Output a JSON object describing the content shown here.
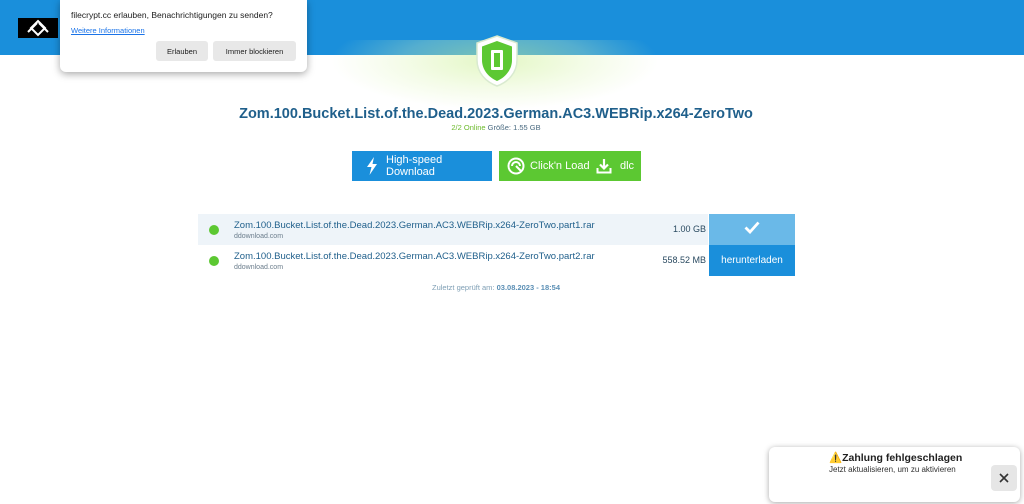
{
  "permission_prompt": {
    "title": "filecrypt.cc erlauben, Benachrichtigungen zu senden?",
    "more_info_link": "Weitere Informationen",
    "allow_button": "Erlauben",
    "block_button": "Immer blockieren"
  },
  "header": {
    "logo_icon": "filecrypt-logo-icon",
    "shield_icon": "shield-icon",
    "colors": {
      "bar": "#1a8fdb",
      "shield": "#5cc832"
    }
  },
  "container": {
    "title": "Zom.100.Bucket.List.of.the.Dead.2023.German.AC3.WEBRip.x264-ZeroTwo",
    "online_status": "2/2 Online",
    "size_label": "Größe: 1.55 GB"
  },
  "buttons": {
    "highspeed": "High-speed Download",
    "clickn_load": "Click'n Load",
    "dlc": "dlc",
    "highspeed_icon": "lightning-icon",
    "clickn_load_icon": "cnl-icon",
    "dlc_icon": "download-icon"
  },
  "files": [
    {
      "name": "Zom.100.Bucket.List.of.the.Dead.2023.German.AC3.WEBRip.x264-ZeroTwo.part1.rar",
      "host": "ddownload.com",
      "size": "1.00 GB",
      "status": "online",
      "action_icon": "checkmark-icon"
    },
    {
      "name": "Zom.100.Bucket.List.of.the.Dead.2023.German.AC3.WEBRip.x264-ZeroTwo.part2.rar",
      "host": "ddownload.com",
      "size": "558.52 MB",
      "status": "online",
      "action_label": "herunterladen"
    }
  ],
  "last_checked": {
    "label": "Zuletzt geprüft am:",
    "value": "03.08.2023 - 18:54"
  },
  "toast": {
    "title": "⚠️Zahlung fehlgeschlagen",
    "message": "Jetzt aktualisieren, um zu aktivieren",
    "close_icon": "close-icon"
  }
}
